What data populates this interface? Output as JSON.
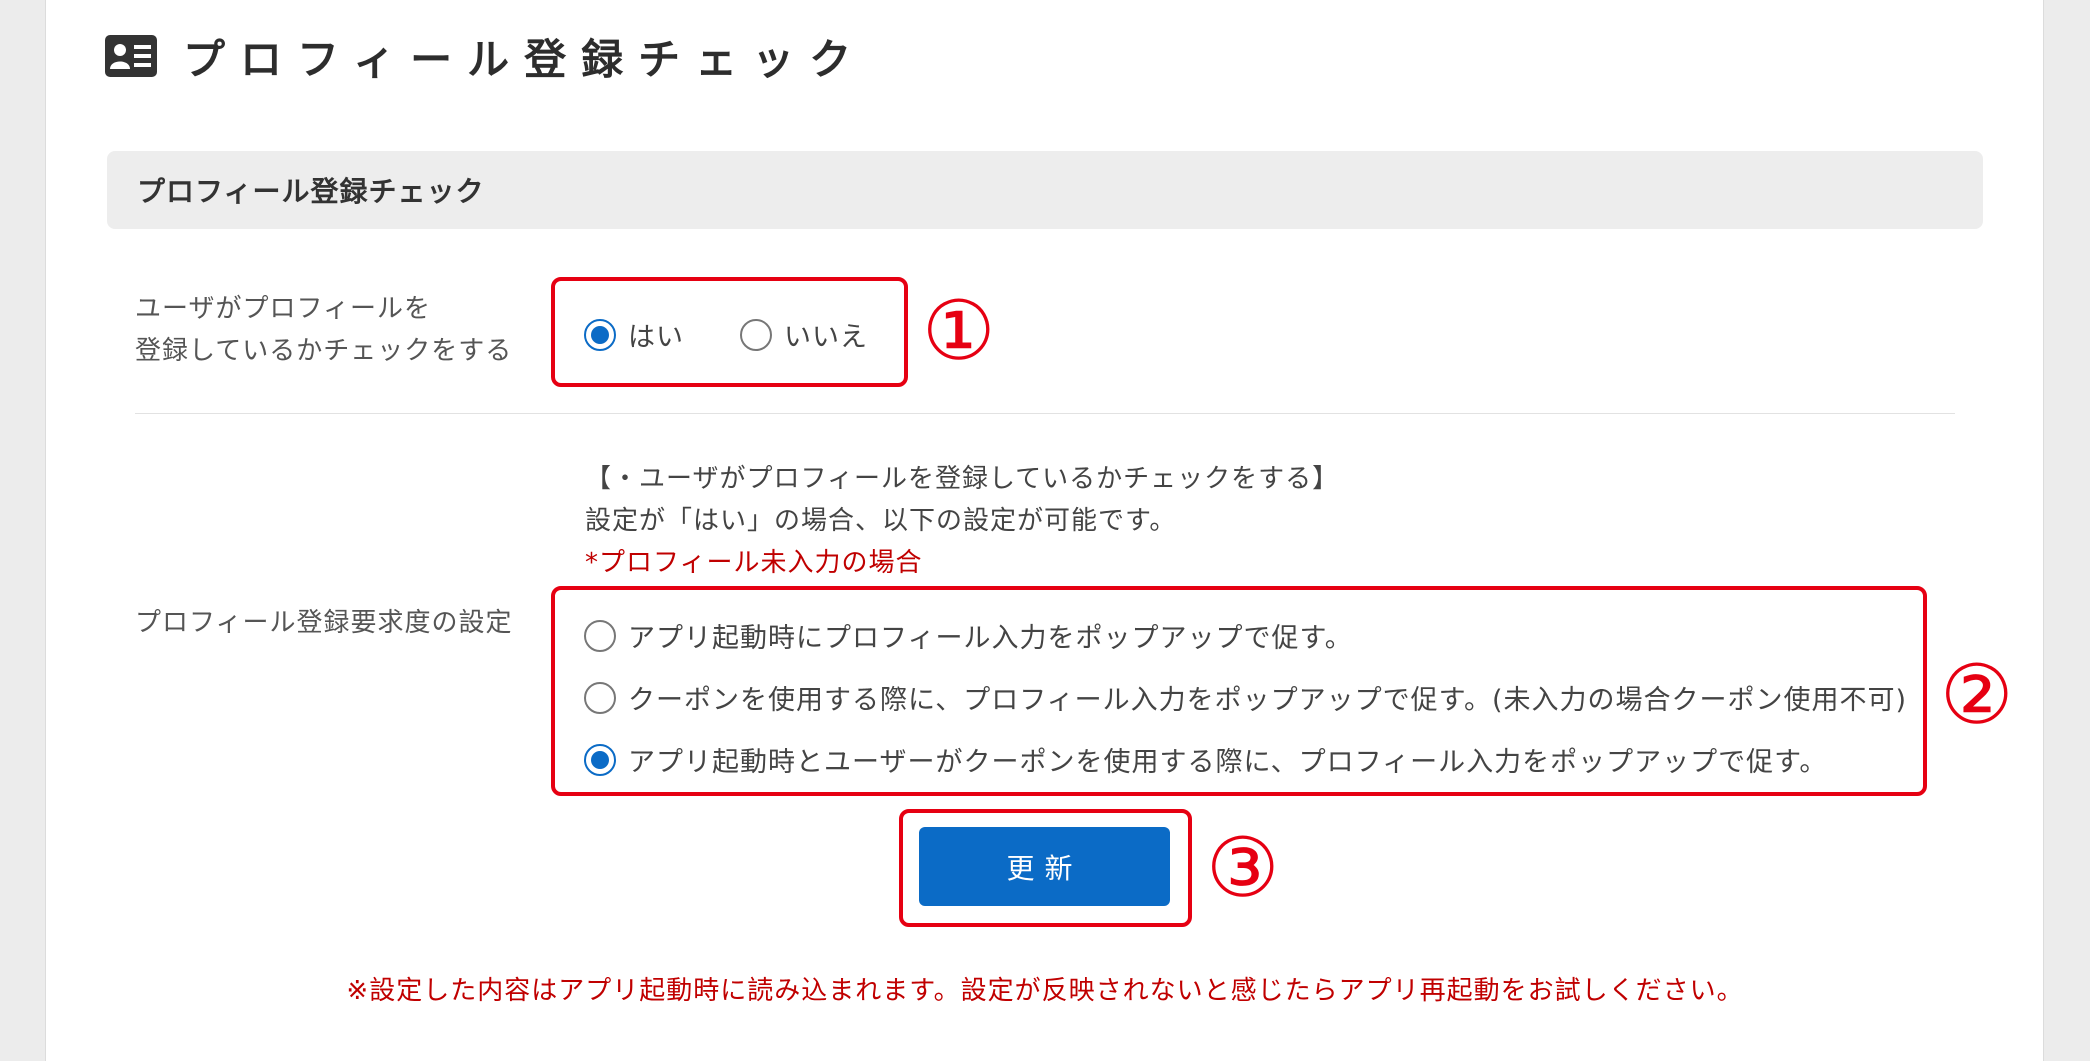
{
  "page": {
    "title": "プロフィール登録チェック",
    "icon": "id-card-icon"
  },
  "section": {
    "header": "プロフィール登録チェック"
  },
  "check_row": {
    "label_line1": "ユーザがプロフィールを",
    "label_line2": "登録しているかチェックをする",
    "options": [
      {
        "label": "はい",
        "selected": true
      },
      {
        "label": "いいえ",
        "selected": false
      }
    ]
  },
  "requirement_row": {
    "label": "プロフィール登録要求度の設定",
    "note_line1": "【・ユーザがプロフィールを登録しているかチェックをする】",
    "note_line2": "設定が「はい」の場合、以下の設定が可能です。",
    "note_red": "*プロフィール未入力の場合",
    "options": [
      {
        "label": "アプリ起動時にプロフィール入力をポップアップで促す。",
        "selected": false
      },
      {
        "label": "クーポンを使用する際に、プロフィール入力をポップアップで促す。(未入力の場合クーポン使用不可)",
        "selected": false
      },
      {
        "label": "アプリ起動時とユーザーがクーポンを使用する際に、プロフィール入力をポップアップで促す。",
        "selected": true
      }
    ]
  },
  "update_button": {
    "label": "更新"
  },
  "footer_note": "※設定した内容はアプリ起動時に読み込まれます。設定が反映されないと感じたらアプリ再起動をお試しください。",
  "annotations": {
    "marker1": "①",
    "marker2": "②",
    "marker3": "③"
  },
  "colors": {
    "accent": "#0b6bc6",
    "highlight_border": "#e60012",
    "warning_text": "#c00000"
  }
}
